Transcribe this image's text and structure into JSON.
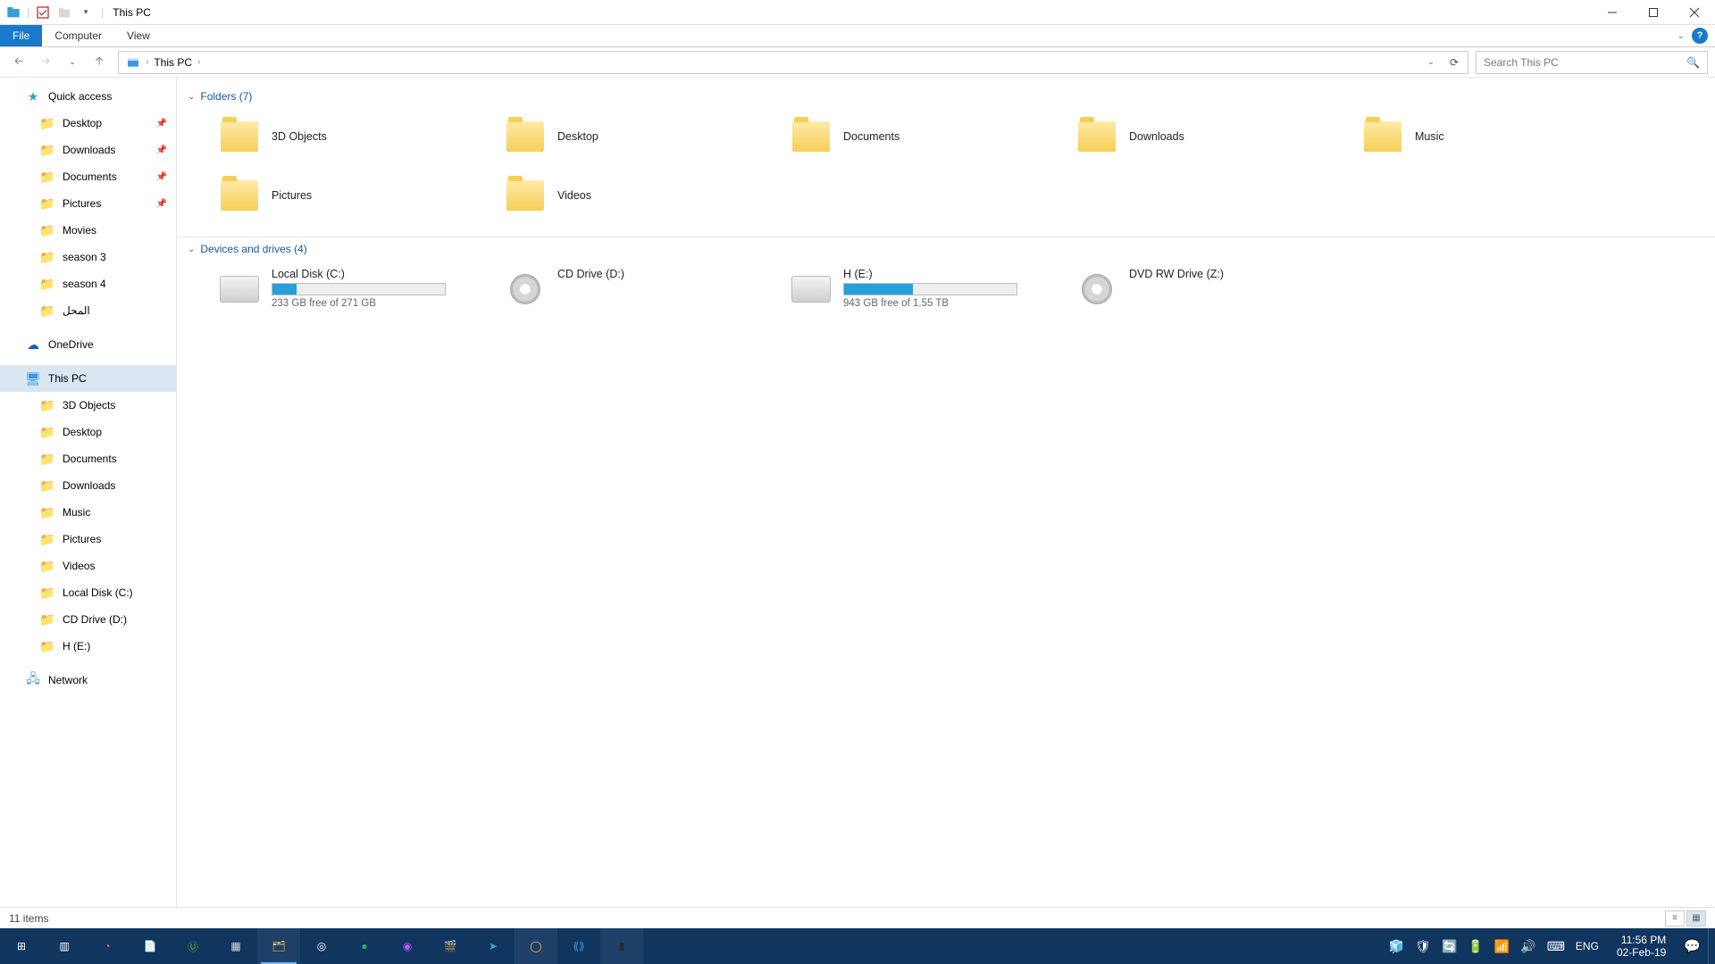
{
  "window": {
    "title": "This PC"
  },
  "ribbon": {
    "file": "File",
    "tabs": [
      "Computer",
      "View"
    ]
  },
  "nav": {
    "address_root": "This PC",
    "search_placeholder": "Search This PC"
  },
  "sidebar": {
    "quick_access": {
      "label": "Quick access",
      "items": [
        {
          "label": "Desktop",
          "pinned": true,
          "icon": "desktop"
        },
        {
          "label": "Downloads",
          "pinned": true,
          "icon": "downloads"
        },
        {
          "label": "Documents",
          "pinned": true,
          "icon": "documents"
        },
        {
          "label": "Pictures",
          "pinned": true,
          "icon": "pictures"
        },
        {
          "label": "Movies",
          "pinned": false,
          "icon": "folder"
        },
        {
          "label": "season 3",
          "pinned": false,
          "icon": "folder"
        },
        {
          "label": "season 4",
          "pinned": false,
          "icon": "folder"
        },
        {
          "label": "المحل",
          "pinned": false,
          "icon": "folder"
        }
      ]
    },
    "onedrive": {
      "label": "OneDrive"
    },
    "this_pc": {
      "label": "This PC",
      "children": [
        {
          "label": "3D Objects"
        },
        {
          "label": "Desktop"
        },
        {
          "label": "Documents"
        },
        {
          "label": "Downloads"
        },
        {
          "label": "Music"
        },
        {
          "label": "Pictures"
        },
        {
          "label": "Videos"
        },
        {
          "label": "Local Disk (C:)"
        },
        {
          "label": "CD Drive (D:)"
        },
        {
          "label": "H (E:)"
        }
      ]
    },
    "network": {
      "label": "Network"
    }
  },
  "groups": {
    "folders": {
      "header": "Folders (7)",
      "items": [
        {
          "label": "3D Objects"
        },
        {
          "label": "Desktop"
        },
        {
          "label": "Documents"
        },
        {
          "label": "Downloads"
        },
        {
          "label": "Music"
        },
        {
          "label": "Pictures"
        },
        {
          "label": "Videos"
        }
      ]
    },
    "drives": {
      "header": "Devices and drives (4)",
      "items": [
        {
          "label": "Local Disk (C:)",
          "free": "233 GB free of 271 GB",
          "fill_pct": 14,
          "type": "hdd"
        },
        {
          "label": "CD Drive (D:)",
          "free": "",
          "fill_pct": null,
          "type": "disc"
        },
        {
          "label": "H (E:)",
          "free": "943 GB free of 1.55 TB",
          "fill_pct": 40,
          "type": "hdd"
        },
        {
          "label": "DVD RW Drive (Z:)",
          "free": "",
          "fill_pct": null,
          "type": "disc"
        }
      ]
    }
  },
  "status": {
    "items": "11 items"
  },
  "taskbar": {
    "apps": [
      {
        "name": "start",
        "glyph": "⊞",
        "color": "#ffffff"
      },
      {
        "name": "task-view",
        "glyph": "▥",
        "color": "#ffffff"
      },
      {
        "name": "edge",
        "glyph": "◔",
        "color": "#ff5a2c"
      },
      {
        "name": "notepad",
        "glyph": "📄",
        "color": "#ffd24a"
      },
      {
        "name": "utorrent",
        "glyph": "Ⓤ",
        "color": "#39c431"
      },
      {
        "name": "calculator",
        "glyph": "▦",
        "color": "#dcdcdc"
      },
      {
        "name": "explorer",
        "glyph": "🗂",
        "color": "#ffcf4a",
        "active": true,
        "open": true
      },
      {
        "name": "settings-ring",
        "glyph": "◎",
        "color": "#ffffff"
      },
      {
        "name": "spotify",
        "glyph": "●",
        "color": "#1db954"
      },
      {
        "name": "media",
        "glyph": "◉",
        "color": "#b852ff"
      },
      {
        "name": "movies",
        "glyph": "🎬",
        "color": "#ffffff"
      },
      {
        "name": "telegram",
        "glyph": "➤",
        "color": "#33a8e0"
      },
      {
        "name": "chrome",
        "glyph": "◯",
        "color": "#f2b63c",
        "open": true
      },
      {
        "name": "vscode",
        "glyph": "⟪⟫",
        "color": "#3c99d4"
      },
      {
        "name": "terminal",
        "glyph": "▮",
        "color": "#2b2b2b",
        "open": true
      }
    ],
    "tray": {
      "lang": "ENG",
      "time": "11:56 PM",
      "date": "02-Feb-19"
    }
  }
}
